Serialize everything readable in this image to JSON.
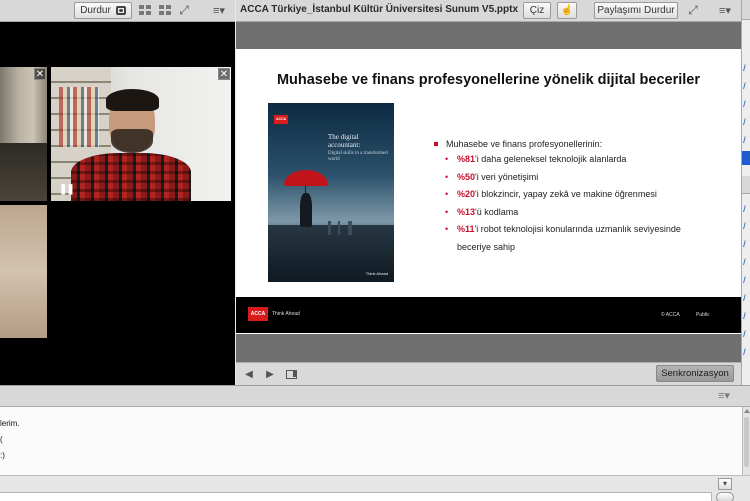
{
  "left_pod": {
    "toolbar": {
      "stop_label": "Durdur",
      "menu_glyph": "≡▾",
      "expand_glyph": "⤢"
    },
    "tiles": [
      {
        "close_glyph": "✕"
      },
      {
        "close_glyph": "✕",
        "pause_glyph": "❚❚"
      }
    ]
  },
  "share_pod": {
    "title": "ACCA Türkiye_İstanbul Kültür Üniversitesi Sunum V5.pptx",
    "draw_label": "Çiz",
    "pointer_glyph": "☝",
    "stop_share_label": "Paylaşımı Durdur",
    "expand_glyph": "⤢",
    "menu_glyph": "≡▾",
    "sync_label": "Senkronizasyon",
    "prev_glyph": "◀",
    "next_glyph": "▶"
  },
  "slide": {
    "title": "Muhasebe ve finans profesyonellerine yönelik dijital beceriler",
    "cover": {
      "logo": "ACCA",
      "title": "The digital accountant:",
      "subtitle": "Digital skills in a transformed world",
      "tag": "Think Ahead"
    },
    "lead": "Muhasebe ve finans profesyonellerinin:",
    "items": [
      {
        "pct": "%81",
        "text": "'i daha geleneksel teknolojik alanlarda"
      },
      {
        "pct": "%50",
        "text": "'i veri yönetişimi"
      },
      {
        "pct": "%20",
        "text": "'i blokzincir, yapay zekâ ve makine öğrenmesi"
      },
      {
        "pct": "%13",
        "text": "'ü kodlama"
      },
      {
        "pct": "%11",
        "text": "'i robot teknolojisi konularında uzmanlık seviyesinde",
        "cont": "beceriye sahip"
      }
    ],
    "footer": {
      "logo": "ACCA",
      "tagline": "Think Ahead",
      "copyright": "© ACCA",
      "classification": "Public"
    }
  },
  "chat": {
    "menu_glyph": "≡▾",
    "messages": [
      "lerim.",
      "(",
      ":)"
    ],
    "input_value": "",
    "target_glyph": "▾"
  },
  "colors": {
    "accent_red": "#c8102e",
    "selection_blue": "#1f5bd0"
  }
}
